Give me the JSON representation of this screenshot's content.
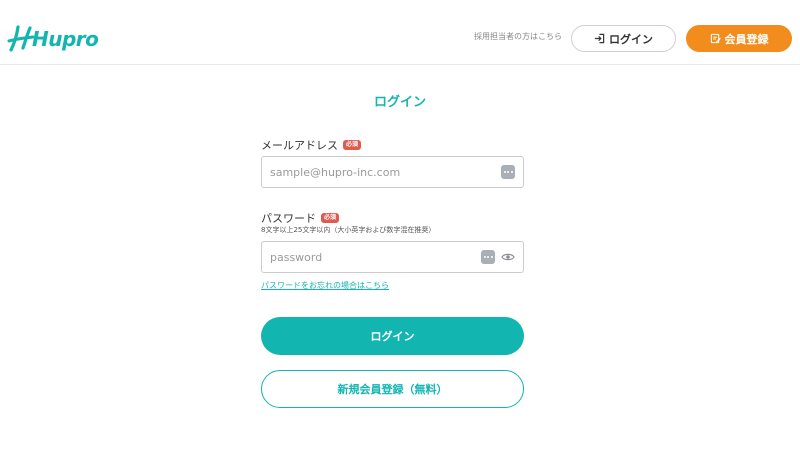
{
  "header": {
    "logo_text": "Hupro",
    "recruiter_link": "採用担当者の方はこちら",
    "login_label": "ログイン",
    "register_label": "会員登録"
  },
  "form": {
    "title": "ログイン",
    "email": {
      "label": "メールアドレス",
      "required_badge": "必須",
      "placeholder": "sample@hupro-inc.com"
    },
    "password": {
      "label": "パスワード",
      "required_badge": "必須",
      "hint": "8文字以上25文字以内（大小英字および数字混在推奨）",
      "placeholder": "password"
    },
    "forgot_link": "パスワードをお忘れの場合はこちら",
    "submit_label": "ログイン",
    "register_label": "新規会員登録（無料）"
  },
  "colors": {
    "brand_teal": "#13b5b1",
    "register_orange": "#f28c1c",
    "required_red": "#e05a4f"
  },
  "icons": {
    "login_icon": "login-arrow-icon",
    "register_icon": "edit-note-icon",
    "autofill_icon": "keyboard-dots-icon",
    "visibility_icon": "eye-icon"
  }
}
